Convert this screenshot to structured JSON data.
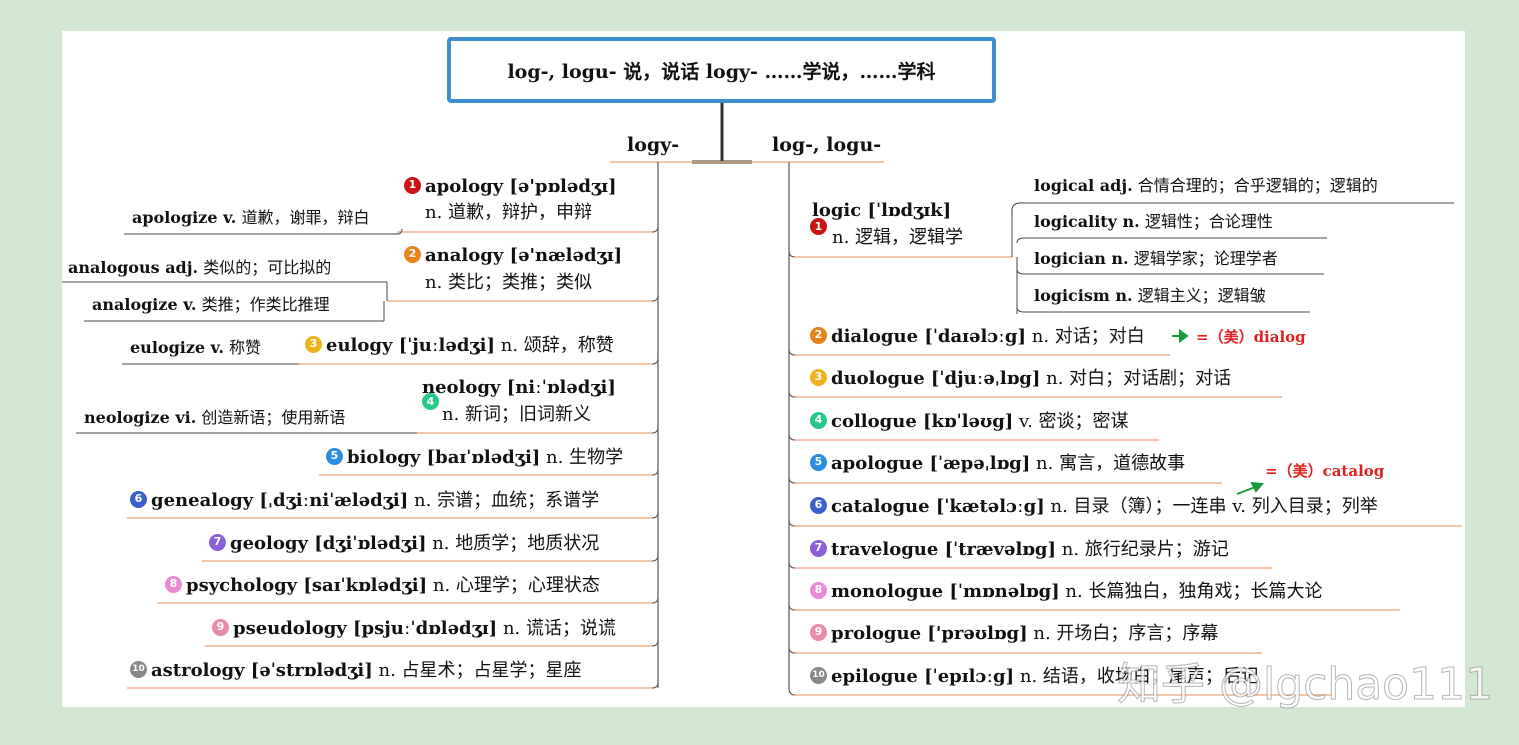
{
  "root_title": "log-, logu- 说，说话   logy- ……学说，……学科",
  "branches": {
    "left": "logy-",
    "right": "log-, logu-"
  },
  "left": [
    {
      "num": "1",
      "color": "#cc1111",
      "word": "apology [ə'pɒlədʒɪ]",
      "meaning": "n. 道歉，辩护，申辩",
      "sub": [
        {
          "word": "apologize v.",
          "meaning": "道歉，谢罪，辩白"
        }
      ]
    },
    {
      "num": "2",
      "color": "#e8821a",
      "word": "analogy [ə'nælədʒɪ]",
      "meaning": "n. 类比；类推；类似",
      "sub": [
        {
          "word": "analogous adj.",
          "meaning": "类似的；可比拟的"
        },
        {
          "word": "analogize v.",
          "meaning": "类推；作类比推理"
        }
      ]
    },
    {
      "num": "3",
      "color": "#f0b21c",
      "word": "eulogy [ˈjuːlədʒi]",
      "meaning": "n. 颂辞，称赞",
      "sub": [
        {
          "word": "eulogize v.",
          "meaning": "称赞"
        }
      ]
    },
    {
      "num": "4",
      "color": "#26c98a",
      "word": "neology [niːˈɒlədʒi]",
      "meaning": "n. 新词；旧词新义",
      "sub": [
        {
          "word": "neologize vi.",
          "meaning": "创造新语；使用新语"
        }
      ]
    },
    {
      "num": "5",
      "color": "#2a8de0",
      "word": "biology [baɪˈɒlədʒi]",
      "meaning": "n. 生物学",
      "sub": []
    },
    {
      "num": "6",
      "color": "#3a5fc8",
      "word": "genealogy [ˌdʒiːniˈælədʒi]",
      "meaning": "n. 宗谱；血统；系谱学",
      "sub": []
    },
    {
      "num": "7",
      "color": "#8a5fd8",
      "word": "geology [dʒiˈɒlədʒi]",
      "meaning": "n. 地质学；地质状况",
      "sub": []
    },
    {
      "num": "8",
      "color": "#e98ad4",
      "word": "psychology [saɪˈkɒlədʒi]",
      "meaning": "n. 心理学；心理状态",
      "sub": []
    },
    {
      "num": "9",
      "color": "#e98aa8",
      "word": "pseudology [psjuːˈdɒlədʒɪ]",
      "meaning": "n. 谎话；说谎",
      "sub": []
    },
    {
      "num": "10",
      "color": "#888888",
      "word": "astrology [əˈstrɒlədʒi]",
      "meaning": "n. 占星术；占星学；星座",
      "sub": []
    }
  ],
  "right": [
    {
      "num": "1",
      "color": "#cc1111",
      "word": "logic [ˈlɒdʒɪk]",
      "meaning": "n. 逻辑，逻辑学",
      "sub": [
        {
          "word": "logical adj.",
          "meaning": "合情合理的；合乎逻辑的；逻辑的"
        },
        {
          "word": "logicality n.",
          "meaning": "逻辑性；合论理性"
        },
        {
          "word": "logician n.",
          "meaning": "逻辑学家；论理学者"
        },
        {
          "word": "logicism n.",
          "meaning": "逻辑主义；逻辑皱"
        }
      ]
    },
    {
      "num": "2",
      "color": "#e8821a",
      "word": "dialogue [ˈdaɪəlɔːg]",
      "meaning": "n. 对话；对白",
      "note": "=（美）dialog"
    },
    {
      "num": "3",
      "color": "#f0b21c",
      "word": "duologue [ˈdjuːəˌlɒg]",
      "meaning": "n. 对白；对话剧；对话"
    },
    {
      "num": "4",
      "color": "#26c98a",
      "word": "collogue [kɒˈləʊg]",
      "meaning": "v. 密谈；密谋"
    },
    {
      "num": "5",
      "color": "#2a8de0",
      "word": "apologue [ˈæpəˌlɒg]",
      "meaning": "n. 寓言，道德故事"
    },
    {
      "num": "6",
      "color": "#3a5fc8",
      "word": "catalogue [ˈkætəlɔːg]",
      "meaning": "n. 目录（簿）；一连串 v. 列入目录；列举",
      "note": "=（美）catalog"
    },
    {
      "num": "7",
      "color": "#8a5fd8",
      "word": "travelogue [ˈtrævəlɒg]",
      "meaning": "n. 旅行纪录片；游记"
    },
    {
      "num": "8",
      "color": "#e98ad4",
      "word": "monologue [ˈmɒnəlɒg]",
      "meaning": "n. 长篇独白，独角戏；长篇大论"
    },
    {
      "num": "9",
      "color": "#e98aa8",
      "word": "prologue ['prəʊlɒg]",
      "meaning": "n. 开场白；序言；序幕"
    },
    {
      "num": "10",
      "color": "#888888",
      "word": "epilogue [ˈepɪlɔːg]",
      "meaning": "n. 结语，收场白；尾声；后记"
    }
  ],
  "watermark": "知乎 @lgchao111"
}
